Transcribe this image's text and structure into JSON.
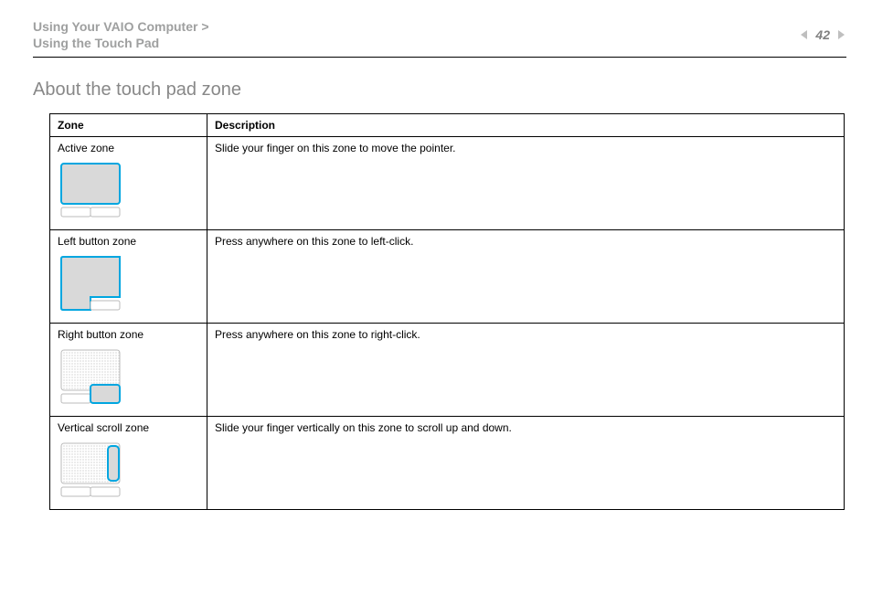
{
  "breadcrumb": {
    "line1": "Using Your VAIO Computer >",
    "line2": "Using the Touch Pad"
  },
  "page_number": "42",
  "section_title": "About the touch pad zone",
  "table": {
    "headers": {
      "zone": "Zone",
      "description": "Description"
    },
    "rows": [
      {
        "zone": "Active zone",
        "description": "Slide your finger on this zone to move the pointer."
      },
      {
        "zone": "Left button zone",
        "description": "Press anywhere on this zone to left-click."
      },
      {
        "zone": "Right button zone",
        "description": "Press anywhere on this zone to right-click."
      },
      {
        "zone": "Vertical scroll zone",
        "description": "Slide your finger vertically on this zone to scroll up and down."
      }
    ]
  }
}
